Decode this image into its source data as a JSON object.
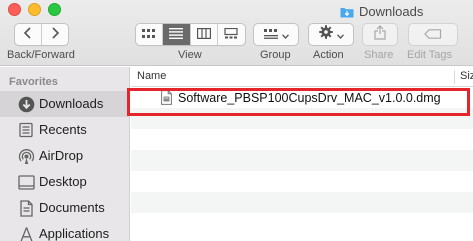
{
  "window": {
    "title": "Downloads"
  },
  "toolbar": {
    "back_forward_label": "Back/Forward",
    "view_label": "View",
    "group_label": "Group",
    "action_label": "Action",
    "share_label": "Share",
    "edit_tags_label": "Edit Tags",
    "active_view": "list",
    "icons": [
      "back-icon",
      "forward-icon",
      "icon-view-icon",
      "list-view-icon",
      "column-view-icon",
      "gallery-view-icon",
      "group-icon",
      "gear-icon",
      "share-icon",
      "tag-icon"
    ]
  },
  "sidebar": {
    "section": "Favorites",
    "items": [
      {
        "label": "Downloads",
        "icon": "downloads-icon",
        "selected": true
      },
      {
        "label": "Recents",
        "icon": "recents-icon"
      },
      {
        "label": "AirDrop",
        "icon": "airdrop-icon"
      },
      {
        "label": "Desktop",
        "icon": "desktop-icon"
      },
      {
        "label": "Documents",
        "icon": "documents-icon"
      },
      {
        "label": "Applications",
        "icon": "applications-icon"
      }
    ]
  },
  "list": {
    "columns": [
      "Name",
      "Siz"
    ],
    "files": [
      {
        "name": "Software_PBSP100CupsDrv_MAC_v1.0.0.dmg",
        "icon": "dmg-file-icon",
        "highlighted": true
      }
    ]
  },
  "colors": {
    "highlight": "#e4262c",
    "folder_accent": "#4aa8ee",
    "sidebar_bg": "#e8e6e8",
    "selected_view": "#6a6a6a"
  }
}
